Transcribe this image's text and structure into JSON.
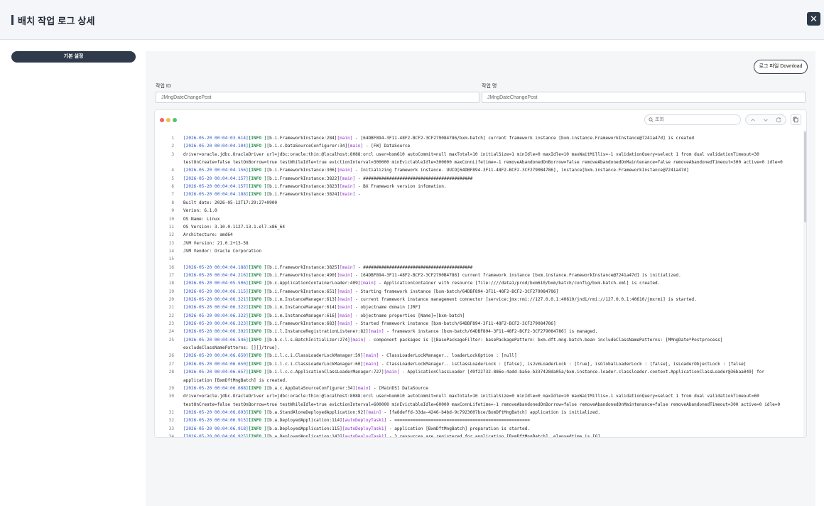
{
  "header": {
    "title": "배치 작업 로그 상세",
    "close_label": "✕"
  },
  "sidebar": {
    "tab_label": "기본 설정"
  },
  "main": {
    "download_label": "로그 파일 Download",
    "job_id_label": "작업 ID",
    "job_id_value": "JMngDateChangePost",
    "job_name_label": "작업 명",
    "job_name_value": "JMngDateChangePost"
  },
  "log": {
    "window_dots": [
      "#f0645a",
      "#f5bd4f",
      "#58c26b"
    ],
    "search_placeholder": "조회",
    "colors": {
      "timestamp": "#2a56c6",
      "level": "#1f8a4c",
      "thread": "#8a2bc2"
    },
    "lines": [
      {
        "n": "1",
        "ts": "[2026-05-20 00:04:03.614]",
        "lvl": "[INFO ]",
        "src": "[b.i.FrameworkInstance:284]",
        "thr": "[main]",
        "msg": " - [64DBF894-3F11-48F2-BCF2-3CF279084786/bxm-batch] current framework instance [bxm.instance.FrameworkInstance@7241a47d] is created"
      },
      {
        "n": "2",
        "ts": "[2026-05-20 00:04:04.104]",
        "lvl": "[INFO ]",
        "src": "[b.i.c.DataSourceConfigurer:34]",
        "thr": "[main]",
        "msg": " -  [FW] DataSource"
      },
      {
        "n": "3",
        "ts": "",
        "lvl": "",
        "src": "",
        "thr": "",
        "msg": " driver=oracle.jdbc.OracleDriver url=jdbc:oracle:thin:@localhost:8088:orcl user=bxm610 autoCommit=null maxTotal=10 initialSize=1 minIdle=0 maxIdle=10 maxWaitMillis=-1 validationQuery=select 1 from dual validationTimeout=30"
      },
      {
        "n": "",
        "ts": "",
        "lvl": "",
        "src": "",
        "thr": "",
        "msg": "testOnCreate=false testOnBorrow=true testWhileIdle=true evictionInterval=300000 minEvictableIdle=300000 maxConnLifetime=-1 removeAbandonedOnBorrow=false removeAbandonedOnMaintenance=false removeAbandonedTimeout=300 active=0 idle=0"
      },
      {
        "n": "4",
        "ts": "[2026-05-20 00:04:04.156]",
        "lvl": "[INFO ]",
        "src": "[b.i.FrameworkInstance:306]",
        "thr": "[main]",
        "msg": " - Initializing framework instance. UUID[64DBF894-3F11-48F2-BCF2-3CF2790B4786], instance[bxm.instance.FrameworkInstance@7241a47d]"
      },
      {
        "n": "5",
        "ts": "[2026-05-20 00:04:04.157]",
        "lvl": "[INFO ]",
        "src": "[b.i.FrameworkInstance:3822]",
        "thr": "[main]",
        "msg": " - ##########################################"
      },
      {
        "n": "6",
        "ts": "[2026-05-20 00:04:04.157]",
        "lvl": "[INFO ]",
        "src": "[b.i.FrameworkInstance:3823]",
        "thr": "[main]",
        "msg": " - BX Framework version infomation."
      },
      {
        "n": "7",
        "ts": "[2026-05-20 00:04:04.188]",
        "lvl": "[INFO ]",
        "src": "[b.i.FrameworkInstance:3824]",
        "thr": "[main]",
        "msg": " -"
      },
      {
        "n": "8",
        "ts": "",
        "lvl": "",
        "src": "",
        "thr": "",
        "msg": "Built date:     2026-05-12T17:29:27+0900"
      },
      {
        "n": "9",
        "ts": "",
        "lvl": "",
        "src": "",
        "thr": "",
        "msg": "Verion:         6.1.0"
      },
      {
        "n": "10",
        "ts": "",
        "lvl": "",
        "src": "",
        "thr": "",
        "msg": "OS Name:        Linux"
      },
      {
        "n": "11",
        "ts": "",
        "lvl": "",
        "src": "",
        "thr": "",
        "msg": "OS Version:     3.10.0-1127.13.1.el7.x86_64"
      },
      {
        "n": "12",
        "ts": "",
        "lvl": "",
        "src": "",
        "thr": "",
        "msg": "Architecture:   amd64"
      },
      {
        "n": "13",
        "ts": "",
        "lvl": "",
        "src": "",
        "thr": "",
        "msg": "JVM Version:    21.0.2+13-58"
      },
      {
        "n": "14",
        "ts": "",
        "lvl": "",
        "src": "",
        "thr": "",
        "msg": "JVM Vendor:     Oracle Corporation"
      },
      {
        "n": "15",
        "ts": "",
        "lvl": "",
        "src": "",
        "thr": "",
        "msg": ""
      },
      {
        "n": "16",
        "ts": "[2026-05-20 00:04:04.188]",
        "lvl": "[INFO ]",
        "src": "[b.i.FrameworkInstance:3825]",
        "thr": "[main]",
        "msg": " - ##########################################"
      },
      {
        "n": "17",
        "ts": "[2026-05-20 00:04:04.216]",
        "lvl": "[INFO ]",
        "src": "[b.i.FrameworkInstance:490]",
        "thr": "[main]",
        "msg": " - [64DBF894-3F11-48F2-BCF2-3CF2790B4786] current framework instance [bxm.instance.FrameworkInstance@7241a47d] is initialized."
      },
      {
        "n": "18",
        "ts": "[2026-05-20 00:04:05.506]",
        "lvl": "[INFO ]",
        "src": "[b.c.ApplicationContainerLoader:409]",
        "thr": "[main]",
        "msg": " - ApplicationContainer with resource [file:////data1/prod/bxm610/bxm/batch/config/bxm-batch.xml] is created."
      },
      {
        "n": "19",
        "ts": "[2026-05-20 00:04:06.115]",
        "lvl": "[INFO ]",
        "src": "[b.i.FrameworkInstance:651]",
        "thr": "[main]",
        "msg": " - Starting framework instance [bxm-batch/64DBF894-3F11-48F2-BCF2-3CF279084786]"
      },
      {
        "n": "20",
        "ts": "[2026-05-20 00:04:06.321]",
        "lvl": "[INFO ]",
        "src": "[b.i.m.InstanceManager:613]",
        "thr": "[main]",
        "msg": " - current framework instance management connector [service:jmx:rmi://127.0.0.1:40610/jndi/rmi://127.0.0.1:40610/jmxrmi] is started."
      },
      {
        "n": "21",
        "ts": "[2026-05-20 00:04:06.322]",
        "lvl": "[INFO ]",
        "src": "[b.i.m.InstanceManager:614]",
        "thr": "[main]",
        "msg": " - objectname domain [JRF]"
      },
      {
        "n": "22",
        "ts": "[2026-05-20 00:04:06.322]",
        "lvl": "[INFO ]",
        "src": "[b.i.m.InstanceManager:616]",
        "thr": "[main]",
        "msg": " - objectname properties [Name]=[bxm-batch]"
      },
      {
        "n": "23",
        "ts": "[2026-05-20 00:04:06.323]",
        "lvl": "[INFO ]",
        "src": "[b.i.FrameworkInstance:683]",
        "thr": "[main]",
        "msg": " - Started framework instance [bxm-batch/64DBF894-3F11-48F2-BCF2-3CF279084786]"
      },
      {
        "n": "24",
        "ts": "[2026-05-20 00:04:06.392]",
        "lvl": "[INFO ]",
        "src": "[b.i.l.InstanceRegistrationListener:82]",
        "thr": "[main]",
        "msg": " - framework instance [bxm-batch/64DBF894-3F11-48F2-BCF2-3CF279084786] is managed."
      },
      {
        "n": "25",
        "ts": "[2026-05-20 00:04:06.546]",
        "lvl": "[INFO ]",
        "src": "[b.b.c.l.s.BatchInitializer:274]",
        "thr": "[main]",
        "msg": " - component packages is [[BasePackageFilter: basePackagePattern: bxm.dft.mng.batch.bean includeClassNamePatterns: [MMngDate*Postprocess]"
      },
      {
        "n": "",
        "ts": "",
        "lvl": "",
        "src": "",
        "thr": "",
        "msg": "excludeClassNamePatterns: []]]/true]."
      },
      {
        "n": "26",
        "ts": "[2026-05-20 00:04:06.650]",
        "lvl": "[INFO ]",
        "src": "[b.i.l.c.i.ClassLoaderLockManager:59]",
        "thr": "[main]",
        "msg": " - ClassLoaderLockManager.. loaderLockOption : [null]"
      },
      {
        "n": "27",
        "ts": "[2026-05-20 00:04:06.650]",
        "lvl": "[INFO ]",
        "src": "[b.i.l.c.i.ClassLoaderLockManager:60]",
        "thr": "[main]",
        "msg": " - ClassLoaderLockManager.. isClassLoaderLock : [false], isJvmLoaderLock : [true], isGlobalLoaderLock : [false], isLoaderObjectLock : [false]"
      },
      {
        "n": "28",
        "ts": "[2026-05-20 00:04:06.657]",
        "lvl": "[INFO ]",
        "src": "[b.i.l.c.c.ApplicationClassLoaderManager:727]",
        "thr": "[main]",
        "msg": " - ApplicationClassLoader [49f22732-886e-4add-ba5e-b337428da05a/bxm.instance.loader.classloader.context.ApplicationClassLoader@36baa049] for"
      },
      {
        "n": "",
        "ts": "",
        "lvl": "",
        "src": "",
        "thr": "",
        "msg": "application [BxmDftMngBatch] is created."
      },
      {
        "n": "29",
        "ts": "[2026-05-20 00:04:06.668]",
        "lvl": "[INFO ]",
        "src": "[b.a.c.AppDataSourceConfigurer:34]",
        "thr": "[main]",
        "msg": " -  [MainDS] DataSource"
      },
      {
        "n": "30",
        "ts": "",
        "lvl": "",
        "src": "",
        "thr": "",
        "msg": " driver=oracle.jdbc.OracleDriver url=jdbc:oracle:thin:@localhost:8088:orcl user=bxm610 autoCommit=null maxTotal=10 initialSize=0 minIdle=0 maxIdle=10 maxWaitMillis=-1 validationQuery=select 1 from dual validationTimeout=60"
      },
      {
        "n": "",
        "ts": "",
        "lvl": "",
        "src": "",
        "thr": "",
        "msg": "testOnCreate=false testOnBorrow=true testWhileIdle=true evictionInterval=600000 minEvictableIdle=60000 maxConnLifetime=-1 removeAbandonedOnBorrow=false removeAbandonedOnMaintenance=false removeAbandonedTimeout=300 active=0 idle=0"
      },
      {
        "n": "31",
        "ts": "[2026-05-20 00:04:06.693]",
        "lvl": "[INFO ]",
        "src": "[b.a.StandAloneDeployedApplication:92]",
        "thr": "[main]",
        "msg": " - [fa8deffd-33da-4246-b4bd-9c7923607bce/BxmDftMngBatch] application is initialized."
      },
      {
        "n": "32",
        "ts": "[2026-05-20 00:04:06.915]",
        "lvl": "[INFO ]",
        "src": "[b.a.DeployedApplication:114]",
        "thr": "[autoDeployTask1]",
        "msg": " - ===================================================="
      },
      {
        "n": "33",
        "ts": "[2026-05-20 00:04:06.918]",
        "lvl": "[INFO ]",
        "src": "[b.a.DeployedApplication:115]",
        "thr": "[autoDeployTask1]",
        "msg": " - application [BxmDftMngBatch] preparation is started."
      },
      {
        "n": "34",
        "ts": "[2026-05-20 00:04:06.925]",
        "lvl": "[INFO ]",
        "src": "[b.a.DeployedApplication:143]",
        "thr": "[autoDeployTask1]",
        "msg": " - 3 resources are registered for application [BxmDftMngBatch], elapsedtime is [6]"
      }
    ]
  }
}
